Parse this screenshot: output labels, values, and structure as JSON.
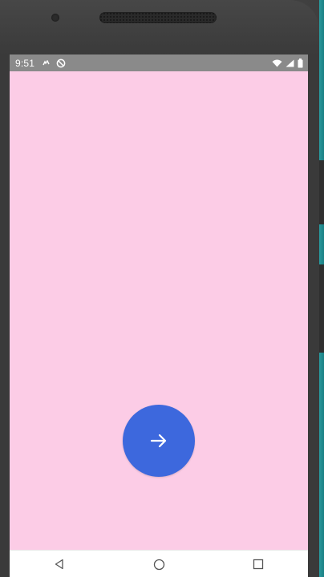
{
  "device": {
    "frame_color": "#3a3a3a",
    "screen_background": "#fccce6"
  },
  "status_bar": {
    "time": "9:51",
    "background": "#8a8a8a",
    "left_icons": [
      "notification-icon",
      "sync-disabled-icon"
    ],
    "right_icons": [
      "wifi-icon",
      "cellular-signal-icon",
      "battery-icon"
    ]
  },
  "main": {
    "fab": {
      "icon": "arrow-right-icon",
      "color": "#3d68dd"
    }
  },
  "nav_bar": {
    "buttons": [
      "back-icon",
      "home-icon",
      "recents-icon"
    ]
  }
}
